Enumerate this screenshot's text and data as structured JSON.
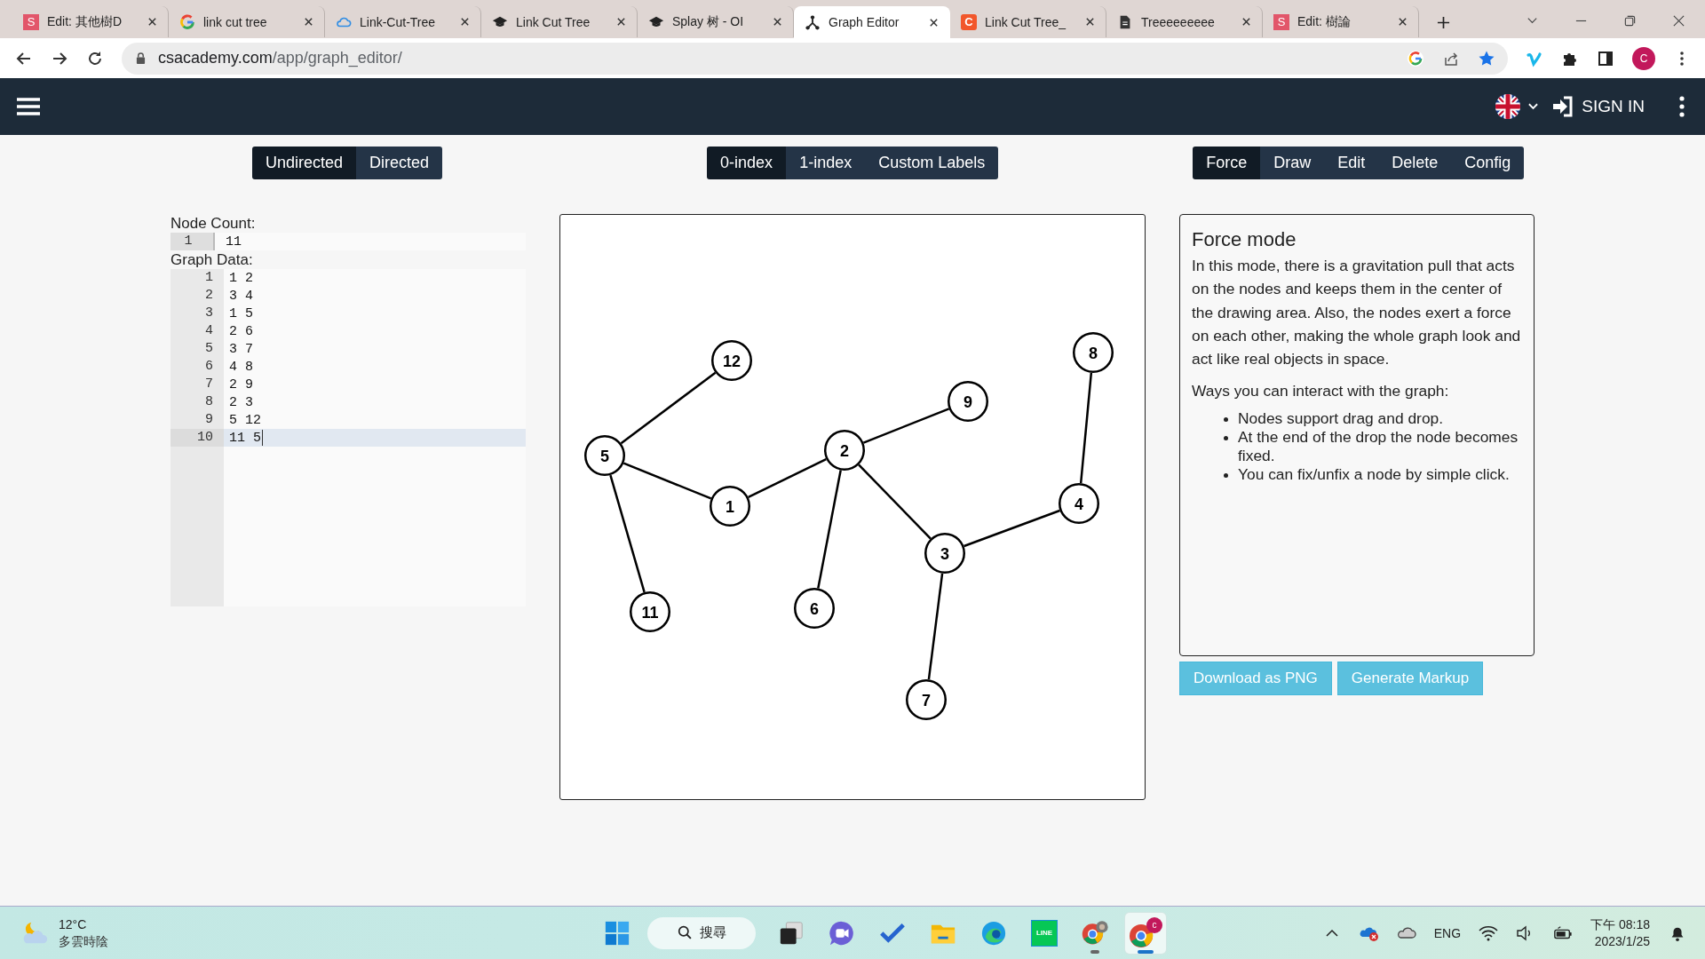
{
  "browser": {
    "tabs": [
      {
        "kind": "letter",
        "icon_text": "S",
        "title": "Edit: 其他樹D",
        "selected": false
      },
      {
        "kind": "google",
        "title": "link cut tree",
        "selected": false
      },
      {
        "kind": "cloud",
        "title": "Link-Cut-Tree",
        "selected": false
      },
      {
        "kind": "cap",
        "title": "Link Cut Tree",
        "selected": false
      },
      {
        "kind": "cap",
        "title": "Splay 树 - OI",
        "selected": false
      },
      {
        "kind": "graph",
        "title": "Graph Editor",
        "selected": true
      },
      {
        "kind": "letter-orange",
        "icon_text": "C",
        "title": "Link Cut Tree_",
        "selected": false
      },
      {
        "kind": "doc",
        "title": "Treeeeeeeee",
        "selected": false
      },
      {
        "kind": "letter",
        "icon_text": "S",
        "title": "Edit: 樹論",
        "selected": false
      }
    ],
    "url": {
      "host": "csacademy.com",
      "path": "/app/graph_editor/"
    },
    "profile_initial": "C"
  },
  "navbar": {
    "sign_in": "SIGN IN"
  },
  "toolbar": {
    "graph_type": [
      {
        "label": "Undirected",
        "selected": true
      },
      {
        "label": "Directed",
        "selected": false
      }
    ],
    "indexing": [
      {
        "label": "0-index",
        "selected": true
      },
      {
        "label": "1-index",
        "selected": false
      },
      {
        "label": "Custom Labels",
        "selected": false
      }
    ],
    "modes": [
      {
        "label": "Force",
        "selected": true
      },
      {
        "label": "Draw",
        "selected": false
      },
      {
        "label": "Edit",
        "selected": false
      },
      {
        "label": "Delete",
        "selected": false
      },
      {
        "label": "Config",
        "selected": false
      }
    ]
  },
  "editor": {
    "node_count_label": "Node Count:",
    "node_count_lines": [
      {
        "number": "1",
        "text": "11",
        "selected": false
      }
    ],
    "graph_data_label": "Graph Data:",
    "graph_data_lines": [
      {
        "number": "1",
        "text": "1 2",
        "selected": false
      },
      {
        "number": "2",
        "text": "3 4",
        "selected": false
      },
      {
        "number": "3",
        "text": "1 5",
        "selected": false
      },
      {
        "number": "4",
        "text": "2 6",
        "selected": false
      },
      {
        "number": "5",
        "text": "3 7",
        "selected": false
      },
      {
        "number": "6",
        "text": "4 8",
        "selected": false
      },
      {
        "number": "7",
        "text": "2 9",
        "selected": false
      },
      {
        "number": "8",
        "text": "2 3",
        "selected": false
      },
      {
        "number": "9",
        "text": "5 12",
        "selected": false
      },
      {
        "number": "10",
        "text": "11 5",
        "selected": true
      }
    ]
  },
  "graph": {
    "nodes": [
      {
        "label": "12"
      },
      {
        "label": "8"
      },
      {
        "label": "9"
      },
      {
        "label": "5"
      },
      {
        "label": "2"
      },
      {
        "label": "1"
      },
      {
        "label": "4"
      },
      {
        "label": "3"
      },
      {
        "label": "11"
      },
      {
        "label": "6"
      },
      {
        "label": "7"
      }
    ]
  },
  "info": {
    "title": "Force mode",
    "paragraph": "In this mode, there is a gravitation pull that acts on the nodes and keeps them in the center of the drawing area. Also, the nodes exert a force on each other, making the whole graph look and act like real objects in space.",
    "subheading": "Ways you can interact with the graph:",
    "bullets": [
      "Nodes support drag and drop.",
      "At the end of the drop the node becomes fixed.",
      "You can fix/unfix a node by simple click."
    ]
  },
  "actions": [
    "Download as PNG",
    "Generate Markup"
  ],
  "taskbar": {
    "weather": {
      "temperature": "12°C",
      "condition": "多雲時陰"
    },
    "search": "搜尋",
    "apps": [
      {
        "kind": "start",
        "running": false,
        "selected": false
      },
      {
        "kind": "taskview",
        "running": false,
        "selected": false
      },
      {
        "kind": "chat",
        "running": false,
        "selected": false
      },
      {
        "kind": "todo",
        "running": false,
        "selected": false
      },
      {
        "kind": "explorer",
        "running": false,
        "selected": false
      },
      {
        "kind": "edge",
        "running": false,
        "selected": false
      },
      {
        "kind": "line",
        "icon_text": "LINE",
        "running": false,
        "selected": false
      },
      {
        "kind": "chrome-photo",
        "running": true,
        "selected": false
      },
      {
        "kind": "chrome-badge",
        "icon_text": "c",
        "running": true,
        "selected": true
      }
    ],
    "language": "ENG",
    "time": "下午 08:18",
    "date": "2023/1/25"
  }
}
